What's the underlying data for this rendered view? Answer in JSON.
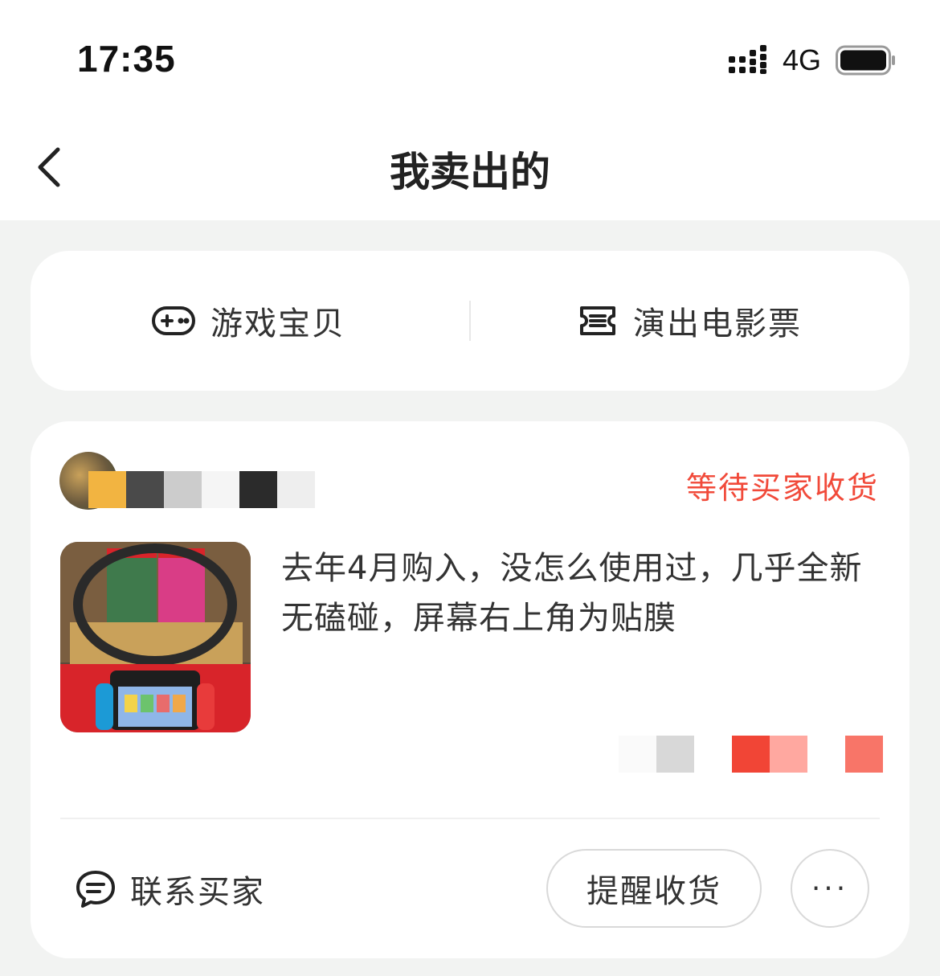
{
  "status_bar": {
    "time": "17:35",
    "network": "4G",
    "icons": [
      "signal-icon",
      "battery-icon"
    ]
  },
  "nav": {
    "title": "我卖出的",
    "back_icon": "chevron-left-icon"
  },
  "categories": [
    {
      "label": "游戏宝贝",
      "icon": "gamepad-icon"
    },
    {
      "label": "演出电影票",
      "icon": "ticket-icon"
    }
  ],
  "order": {
    "status": "等待买家收货",
    "seller_name_blurred": [
      "#f2b441",
      "#4a4a4a",
      "#cccccc",
      "#f5f5f5",
      "#2b2b2b",
      "#eeeeee"
    ],
    "product_title": "去年4月购入，没怎么使用过，几乎全新无磕碰，屏幕右上角为贴膜",
    "price_blurred": [
      "#fafafa",
      "#d8d8d8",
      "#ffffff",
      "#f14536",
      "#ffa8a0",
      "#ffffff",
      "#f87568"
    ],
    "contact_label": "联系买家",
    "contact_icon": "chat-bubble-icon",
    "remind_label": "提醒收货",
    "more_label": "···"
  },
  "colors": {
    "status_red": "#f14a3a",
    "page_bg": "#f2f3f2",
    "card_bg": "#ffffff"
  }
}
